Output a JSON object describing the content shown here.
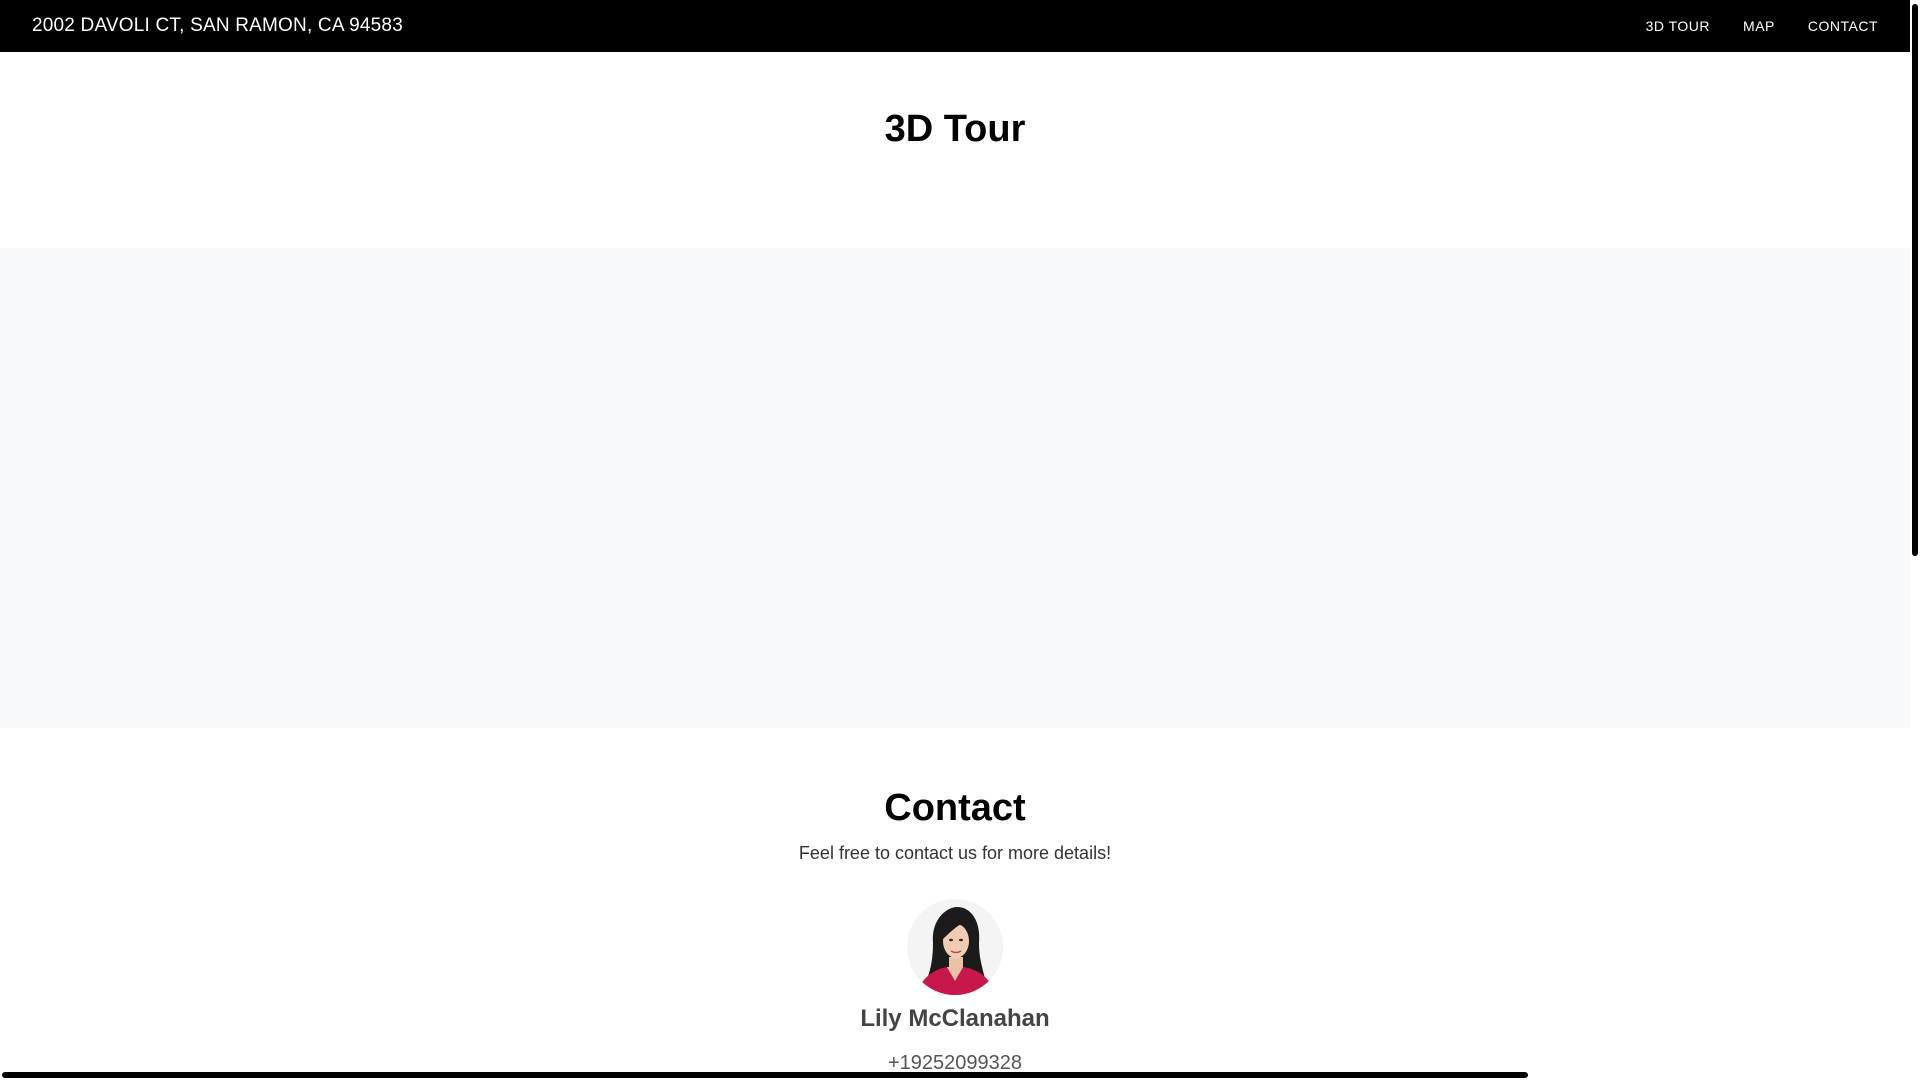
{
  "header": {
    "title": "2002 DAVOLI CT, SAN RAMON, CA 94583",
    "nav": [
      {
        "label": "3D TOUR"
      },
      {
        "label": "MAP"
      },
      {
        "label": "CONTACT"
      }
    ]
  },
  "tour": {
    "title": "3D Tour"
  },
  "contact": {
    "title": "Contact",
    "subtitle": "Feel free to contact us for more details!",
    "agent": {
      "name": "Lily McClanahan",
      "phone": "+19252099328"
    }
  },
  "colors": {
    "header_bg": "#000000",
    "tour_bg": "#f8f9fb",
    "accent_red": "#c8174a"
  }
}
